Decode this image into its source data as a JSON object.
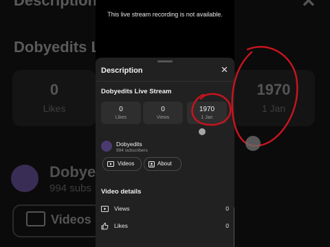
{
  "background": {
    "header_title": "Description",
    "stream_title": "Dobyedits L",
    "likes_value": "0",
    "likes_label": "Likes",
    "year_value": "1970",
    "date_label": "1 Jan",
    "channel_name": "Dobyed",
    "subscribers": "994 subs",
    "videos_button": "Videos"
  },
  "player": {
    "unavailable_message": "This live stream recording is not available."
  },
  "sheet": {
    "title": "Description",
    "close_glyph": "✕",
    "stream_title": "Dobyedits Live Stream",
    "stats": [
      {
        "value": "0",
        "label": "Likes"
      },
      {
        "value": "0",
        "label": "Views"
      },
      {
        "value": "1970",
        "label": "1 Jan"
      }
    ],
    "channel": {
      "name": "Dobyedits",
      "subscribers": "994 subscribers",
      "videos_label": "Videos",
      "about_label": "About"
    },
    "video_details": {
      "title": "Video details",
      "rows": [
        {
          "icon": "play-box-icon",
          "label": "Views",
          "value": "0"
        },
        {
          "icon": "thumbs-up-icon",
          "label": "Likes",
          "value": "0"
        }
      ]
    }
  },
  "colors": {
    "annotation": "#c8141e",
    "sheet_bg": "#212121",
    "card_bg": "#2e2e2e"
  }
}
